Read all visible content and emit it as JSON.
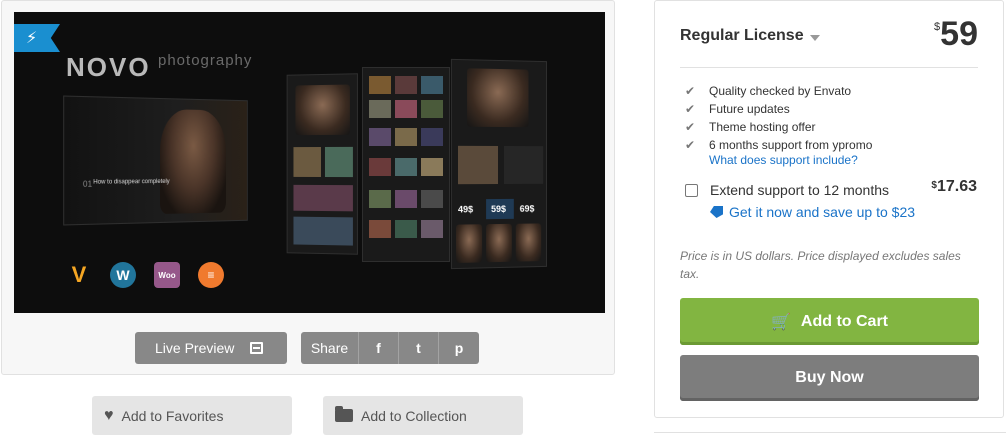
{
  "preview": {
    "brand": "NOVO",
    "brand_sub": "photography",
    "slide_number": "01",
    "slide_caption": "How to disappear completely",
    "prices": [
      "49$",
      "59$",
      "69$"
    ],
    "logos": [
      {
        "icon": "visual-composer-icon",
        "label": "V"
      },
      {
        "icon": "wordpress-icon",
        "label": "W"
      },
      {
        "icon": "woocommerce-icon",
        "label": "Woo"
      },
      {
        "icon": "customizer-icon",
        "label": "≡"
      }
    ]
  },
  "actions": {
    "live_preview": "Live Preview",
    "share": "Share",
    "share_icons": [
      "f",
      "t",
      "p"
    ],
    "add_favorites": "Add to Favorites",
    "add_collection": "Add to Collection"
  },
  "purchase": {
    "license": "Regular License",
    "currency": "$",
    "price": "59",
    "features": [
      "Quality checked by Envato",
      "Future updates",
      "Theme hosting offer",
      "6 months support from ypromo"
    ],
    "support_link": "What does support include?",
    "extend_label": "Extend support to 12 months",
    "extend_price": "17.63",
    "save_link": "Get it now and save up to $23",
    "disclaimer": "Price is in US dollars. Price displayed excludes sales tax.",
    "add_to_cart": "Add to Cart",
    "buy_now": "Buy Now"
  },
  "colors": {
    "accent_green": "#82b541",
    "link_blue": "#1a73c8",
    "badge_blue": "#1a8fd0"
  }
}
